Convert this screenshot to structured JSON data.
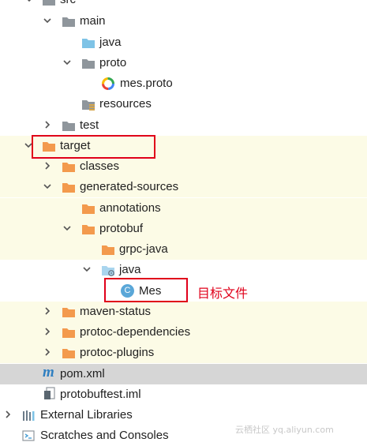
{
  "colors": {
    "highlight": "#e0001a",
    "folder_gray": "#8f969c",
    "folder_orange": "#f39a4d",
    "folder_blue": "#7ec3e6",
    "selection": "#d6d6d6",
    "band": "#fcfbe6"
  },
  "tree": {
    "src": "src",
    "main": "main",
    "java_main": "java",
    "proto": "proto",
    "mes_proto": "mes.proto",
    "resources": "resources",
    "test": "test",
    "target": "target",
    "classes": "classes",
    "generated_sources": "generated-sources",
    "annotations": "annotations",
    "protobuf": "protobuf",
    "grpc_java": "grpc-java",
    "java_gen": "java",
    "mes_class": "Mes",
    "class_badge": "C",
    "maven_status": "maven-status",
    "protoc_dependencies": "protoc-dependencies",
    "protoc_plugins": "protoc-plugins",
    "pom_xml": "pom.xml",
    "pom_badge": "m",
    "iml": "protobuftest.iml",
    "external_libraries": "External Libraries",
    "scratches": "Scratches and Consoles"
  },
  "annotation": "目标文件",
  "watermark": "云栖社区 yq.aliyun.com"
}
